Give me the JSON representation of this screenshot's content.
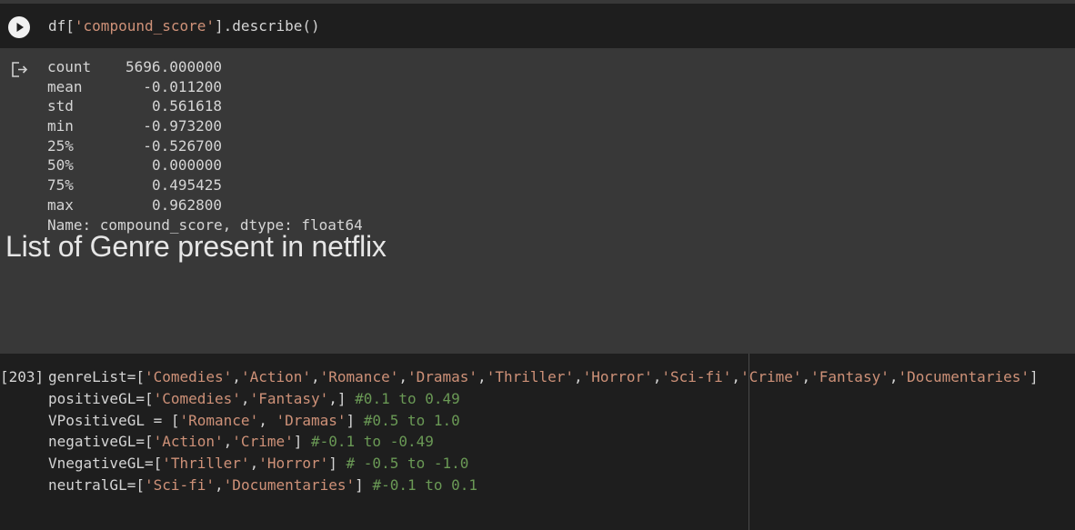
{
  "cell1": {
    "code_prefix": "df[",
    "code_string": "'compound_score'",
    "code_suffix": "].describe()"
  },
  "output": {
    "rows": [
      {
        "key": "count",
        "value": "5696.000000"
      },
      {
        "key": "mean",
        "value": "-0.011200"
      },
      {
        "key": "std",
        "value": "0.561618"
      },
      {
        "key": "min",
        "value": "-0.973200"
      },
      {
        "key": "25%",
        "value": "-0.526700"
      },
      {
        "key": "50%",
        "value": "0.000000"
      },
      {
        "key": "75%",
        "value": "0.495425"
      },
      {
        "key": "max",
        "value": "0.962800"
      }
    ],
    "footer": "Name: compound_score, dtype: float64"
  },
  "markdown": {
    "heading": "List of Genre present in netflix"
  },
  "cell2": {
    "exec_count": "[203]",
    "lines": [
      {
        "code": "genreList=[",
        "strings": [
          "'Comedies'",
          "'Action'",
          "'Romance'",
          "'Dramas'",
          "'Thriller'",
          "'Horror'",
          "'Sci-fi'",
          "'Crime'",
          "'Fantasy'",
          "'Documentaries'"
        ],
        "sep": ",",
        "close": "]",
        "comment": ""
      },
      {
        "code": "positiveGL=[",
        "strings": [
          "'Comedies'",
          "'Fantasy'"
        ],
        "sep": ",",
        "close": ",] ",
        "comment": "#0.1 to 0.49"
      },
      {
        "code": "VPositiveGL = [",
        "strings": [
          "'Romance'",
          "'Dramas'"
        ],
        "sep": ", ",
        "close": "] ",
        "comment": "#0.5 to 1.0"
      },
      {
        "code": "negativeGL=[",
        "strings": [
          "'Action'",
          "'Crime'"
        ],
        "sep": ",",
        "close": "] ",
        "comment": "#-0.1 to -0.49"
      },
      {
        "code": "VnegativeGL=[",
        "strings": [
          "'Thriller'",
          "'Horror'"
        ],
        "sep": ",",
        "close": "] ",
        "comment": "# -0.5 to -1.0"
      },
      {
        "code": "neutralGL=[",
        "strings": [
          "'Sci-fi'",
          "'Documentaries'"
        ],
        "sep": ",",
        "close": "] ",
        "comment": "#-0.1 to 0.1"
      }
    ]
  },
  "colors": {
    "string": "#ce9178",
    "comment": "#6a9955",
    "code_bg": "#1e1e1e",
    "output_bg": "#383838"
  },
  "icons": {
    "run": "play-icon",
    "output": "output-icon"
  }
}
